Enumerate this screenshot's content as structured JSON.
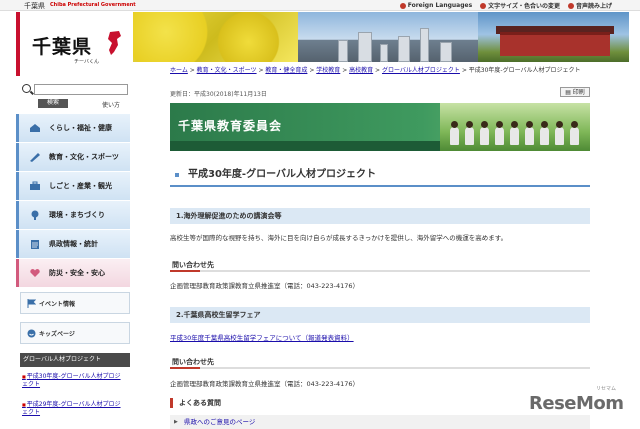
{
  "topbar": {
    "pref_name": "千葉県",
    "pref_name_en": "Chiba Prefectural Government",
    "links": [
      "Foreign Languages",
      "文字サイズ・色合いの変更",
      "音声読み上げ"
    ]
  },
  "logo": {
    "name": "千葉県",
    "kana": "チーバくん"
  },
  "search": {
    "button": "検索",
    "howto": "使い方"
  },
  "sidebar": {
    "nav": [
      {
        "label": "くらし・福祉・健康",
        "icon": "house-icon"
      },
      {
        "label": "教育・文化・スポーツ",
        "icon": "pen-icon"
      },
      {
        "label": "しごと・産業・観光",
        "icon": "briefcase-icon"
      },
      {
        "label": "環境・まちづくり",
        "icon": "tree-icon"
      },
      {
        "label": "県政情報・統計",
        "icon": "document-icon"
      },
      {
        "label": "防災・安全・安心",
        "icon": "heart-icon"
      }
    ],
    "event": "イベント情報",
    "kids": "キッズページ",
    "section_title": "グローバル人材プロジェクト",
    "links": [
      "平成30年度-グローバル人材プロジェクト",
      "平成29年度-グローバル人材プロジェクト"
    ]
  },
  "breadcrumb": {
    "items": [
      "ホーム",
      "教育・文化・スポーツ",
      "教育・健全育成",
      "学校教育",
      "高校教育",
      "グローバル人材プロジェクト"
    ],
    "current": "平成30年度-グローバル人材プロジェクト"
  },
  "updated": "更新日：平成30(2018)年11月13日",
  "print": "印刷",
  "banner_title": "千葉県教育委員会",
  "page_title": "平成30年度-グローバル人材プロジェクト",
  "sections": [
    {
      "heading": "1.海外理解促進のための講演会等",
      "body": "高校生等が国際的な視野を持ち、海外に目を向け自らが成長するきっかけを提供し、海外留学への機運を高めます。",
      "contact_heading": "問い合わせ先",
      "contact": "企画管理部教育政策課教育立県推進室（電話：043-223-4176）"
    },
    {
      "heading": "2.千葉県高校生留学フェア",
      "link": "平成30年度千葉県高校生留学フェアについて（報道発表資料）",
      "contact_heading": "問い合わせ先",
      "contact": "企画管理部教育政策課教育立県推進室（電話：043-223-4176）"
    }
  ],
  "faq": {
    "heading": "よくある質問",
    "item": "県政へのご意見のページ"
  },
  "watermark": {
    "brand": "ReseMom",
    "small": "リセマム"
  },
  "colors": {
    "accent": "#5b8fc8",
    "brand_red": "#c8102e",
    "banner_green": "#2c7a4a"
  }
}
